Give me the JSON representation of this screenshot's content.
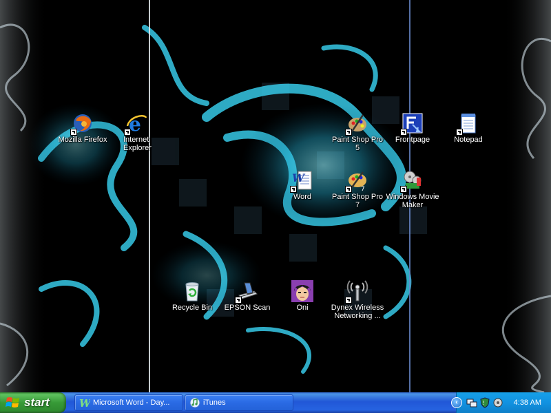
{
  "desktop": {
    "icons": [
      {
        "id": "firefox",
        "label": "Mozilla Firefox",
        "icon": "firefox-icon",
        "shortcut": true
      },
      {
        "id": "ie",
        "label": "Internet Explorer",
        "icon": "internet-explorer-icon",
        "shortcut": true
      },
      {
        "id": "psp5",
        "label": "Paint Shop Pro 5",
        "icon": "paint-shop-pro-icon",
        "shortcut": true
      },
      {
        "id": "frontpage",
        "label": "Frontpage",
        "icon": "frontpage-icon",
        "shortcut": true
      },
      {
        "id": "notepad",
        "label": "Notepad",
        "icon": "notepad-icon",
        "shortcut": true
      },
      {
        "id": "word",
        "label": "Word",
        "icon": "word-icon",
        "shortcut": true
      },
      {
        "id": "psp7",
        "label": "Paint Shop Pro 7",
        "icon": "paint-shop-pro-icon",
        "shortcut": true
      },
      {
        "id": "moviemaker",
        "label": "Windows Movie Maker",
        "icon": "movie-maker-icon",
        "shortcut": true
      },
      {
        "id": "recycle",
        "label": "Recycle Bin",
        "icon": "recycle-bin-icon",
        "shortcut": false
      },
      {
        "id": "epson",
        "label": "EPSON Scan",
        "icon": "scanner-icon",
        "shortcut": true
      },
      {
        "id": "oni",
        "label": "Oni",
        "icon": "oni-icon",
        "shortcut": false
      },
      {
        "id": "dynex",
        "label": "Dynex Wireless Networking ...",
        "icon": "wireless-antenna-icon",
        "shortcut": true
      }
    ]
  },
  "taskbar": {
    "start_label": "start",
    "tasks": [
      {
        "label": "Microsoft Word - Day...",
        "icon": "word-icon"
      },
      {
        "label": "iTunes",
        "icon": "itunes-icon"
      }
    ],
    "tray": {
      "icons": [
        "network-icon",
        "shield-icon",
        "volume-icon"
      ],
      "clock": "4:38 AM"
    }
  },
  "colors": {
    "taskbar_blue": "#2157d7",
    "start_green": "#379a37",
    "tray_blue": "#1292e1",
    "wallpaper_cyan": "#37c8e6"
  }
}
